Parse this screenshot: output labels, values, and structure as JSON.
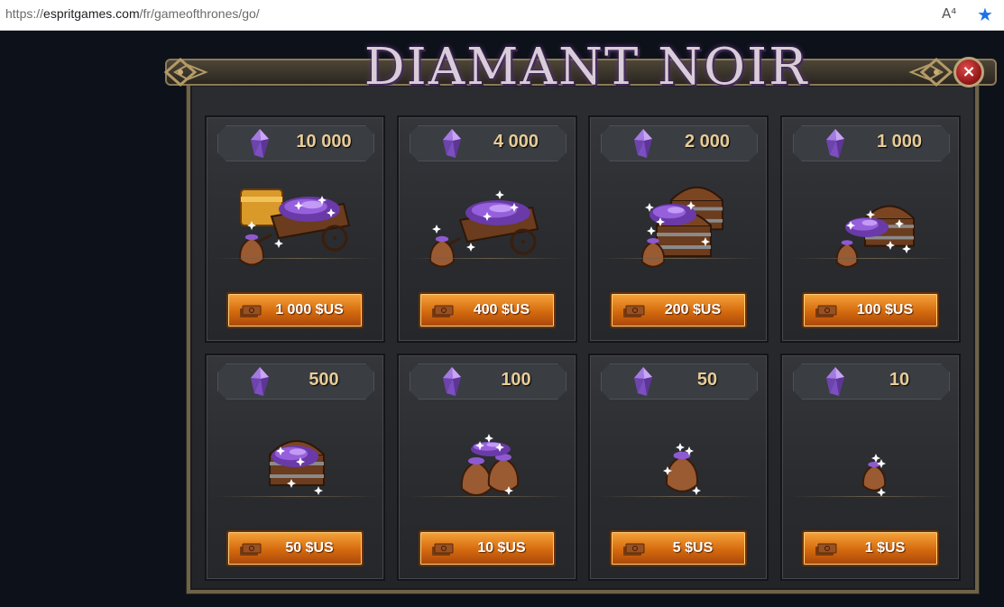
{
  "browser": {
    "url_proto": "https://",
    "url_host": "espritgames.com",
    "url_path": "/fr/gameofthrones/go/",
    "read_aloud_icon": "A⁴",
    "favorite_icon": "★"
  },
  "dialog": {
    "title": "DIAMANT NOIR",
    "close_symbol": "×"
  },
  "colors": {
    "gem": "#8e5ad1",
    "button": "#e07a1a",
    "amount_text": "#e8cc96"
  },
  "packages": [
    {
      "amount": "10 000",
      "price": "1 000 $US",
      "art": "cart-with-chest"
    },
    {
      "amount": "4 000",
      "price": "400 $US",
      "art": "cart"
    },
    {
      "amount": "2 000",
      "price": "200 $US",
      "art": "chest-stack"
    },
    {
      "amount": "1 000",
      "price": "100 $US",
      "art": "chest-with-bag"
    },
    {
      "amount": "500",
      "price": "50 $US",
      "art": "chest"
    },
    {
      "amount": "100",
      "price": "10 $US",
      "art": "bags"
    },
    {
      "amount": "50",
      "price": "5 $US",
      "art": "bag"
    },
    {
      "amount": "10",
      "price": "1 $US",
      "art": "small-bag"
    }
  ]
}
